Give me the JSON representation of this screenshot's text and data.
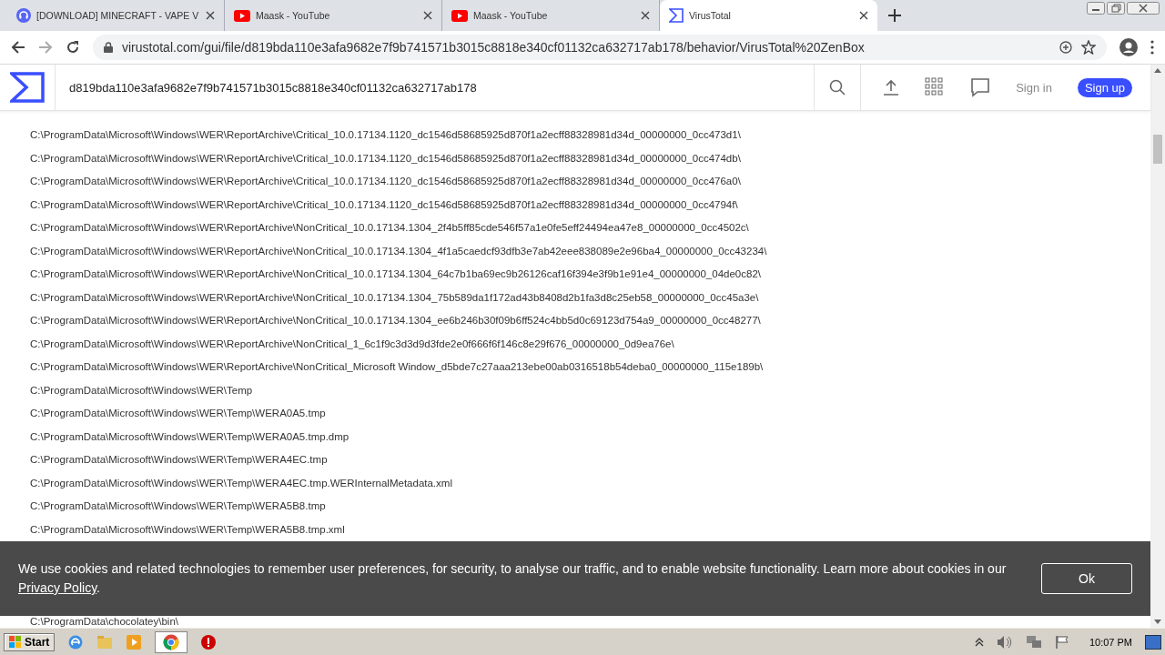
{
  "browser": {
    "tabs": [
      {
        "title": "[DOWNLOAD] MINECRAFT - VAPE V",
        "kind": "discord",
        "selected": false
      },
      {
        "title": "Maask - YouTube",
        "kind": "youtube",
        "selected": false
      },
      {
        "title": "Maask - YouTube",
        "kind": "youtube",
        "selected": false
      },
      {
        "title": "VirusTotal",
        "kind": "virustotal",
        "selected": true
      }
    ],
    "url": "virustotal.com/gui/file/d819bda110e3afa9682e7f9b741571b3015c8818e340cf01132ca632717ab178/behavior/VirusTotal%20ZenBox"
  },
  "header": {
    "search_value": "d819bda110e3afa9682e7f9b741571b3015c8818e340cf01132ca632717ab178",
    "sign_in": "Sign in",
    "sign_up": "Sign up"
  },
  "paths": [
    "C:\\ProgramData\\Microsoft\\Windows\\WER\\ReportArchive\\Critical_10.0.17134.1120_dc1546d58685925d870f1a2ecff88328981d34d_00000000_0cc473d1\\",
    "C:\\ProgramData\\Microsoft\\Windows\\WER\\ReportArchive\\Critical_10.0.17134.1120_dc1546d58685925d870f1a2ecff88328981d34d_00000000_0cc474db\\",
    "C:\\ProgramData\\Microsoft\\Windows\\WER\\ReportArchive\\Critical_10.0.17134.1120_dc1546d58685925d870f1a2ecff88328981d34d_00000000_0cc476a0\\",
    "C:\\ProgramData\\Microsoft\\Windows\\WER\\ReportArchive\\Critical_10.0.17134.1120_dc1546d58685925d870f1a2ecff88328981d34d_00000000_0cc4794f\\",
    "C:\\ProgramData\\Microsoft\\Windows\\WER\\ReportArchive\\NonCritical_10.0.17134.1304_2f4b5ff85cde546f57a1e0fe5eff24494ea47e8_00000000_0cc4502c\\",
    "C:\\ProgramData\\Microsoft\\Windows\\WER\\ReportArchive\\NonCritical_10.0.17134.1304_4f1a5caedcf93dfb3e7ab42eee838089e2e96ba4_00000000_0cc43234\\",
    "C:\\ProgramData\\Microsoft\\Windows\\WER\\ReportArchive\\NonCritical_10.0.17134.1304_64c7b1ba69ec9b26126caf16f394e3f9b1e91e4_00000000_04de0c82\\",
    "C:\\ProgramData\\Microsoft\\Windows\\WER\\ReportArchive\\NonCritical_10.0.17134.1304_75b589da1f172ad43b8408d2b1fa3d8c25eb58_00000000_0cc45a3e\\",
    "C:\\ProgramData\\Microsoft\\Windows\\WER\\ReportArchive\\NonCritical_10.0.17134.1304_ee6b246b30f09b6ff524c4bb5d0c69123d754a9_00000000_0cc48277\\",
    "C:\\ProgramData\\Microsoft\\Windows\\WER\\ReportArchive\\NonCritical_1_6c1f9c3d3d9d3fde2e0f666f6f146c8e29f676_00000000_0d9ea76e\\",
    "C:\\ProgramData\\Microsoft\\Windows\\WER\\ReportArchive\\NonCritical_Microsoft Window_d5bde7c27aaa213ebe00ab0316518b54deba0_00000000_115e189b\\",
    "C:\\ProgramData\\Microsoft\\Windows\\WER\\Temp",
    "C:\\ProgramData\\Microsoft\\Windows\\WER\\Temp\\WERA0A5.tmp",
    "C:\\ProgramData\\Microsoft\\Windows\\WER\\Temp\\WERA0A5.tmp.dmp",
    "C:\\ProgramData\\Microsoft\\Windows\\WER\\Temp\\WERA4EC.tmp",
    "C:\\ProgramData\\Microsoft\\Windows\\WER\\Temp\\WERA4EC.tmp.WERInternalMetadata.xml",
    "C:\\ProgramData\\Microsoft\\Windows\\WER\\Temp\\WERA5B8.tmp",
    "C:\\ProgramData\\Microsoft\\Windows\\WER\\Temp\\WERA5B8.tmp.xml"
  ],
  "paths_below_banner": [
    "C:\\ProgramData\\chocolatey\\bin\\"
  ],
  "cookie_banner": {
    "text": "We use cookies and related technologies to remember user preferences, for security, to analyse our traffic, and to enable website functionality. Learn more about cookies in our",
    "link": "Privacy Policy",
    "end": ".",
    "button": "Ok"
  },
  "taskbar": {
    "start": "Start",
    "clock": "10:07 PM"
  }
}
